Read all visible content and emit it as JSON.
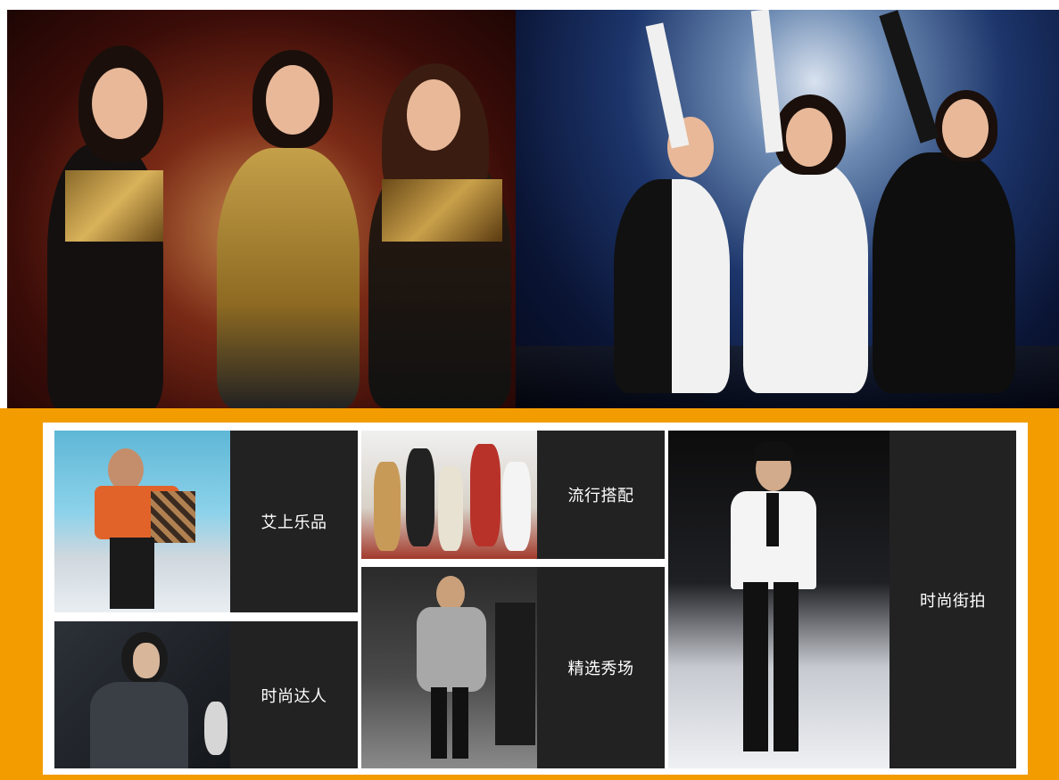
{
  "hero": {
    "left_image": "stage-performance-gold-outfits-photo",
    "right_image": "stage-performance-black-white-dance-photo"
  },
  "categories": [
    {
      "label": "艾上乐品"
    },
    {
      "label": "时尚达人"
    },
    {
      "label": "流行搭配"
    },
    {
      "label": "精选秀场"
    },
    {
      "label": "时尚街拍"
    }
  ],
  "colors": {
    "panel_background": "#f39c00",
    "card_background": "#222222",
    "label_text": "#ffffff"
  }
}
